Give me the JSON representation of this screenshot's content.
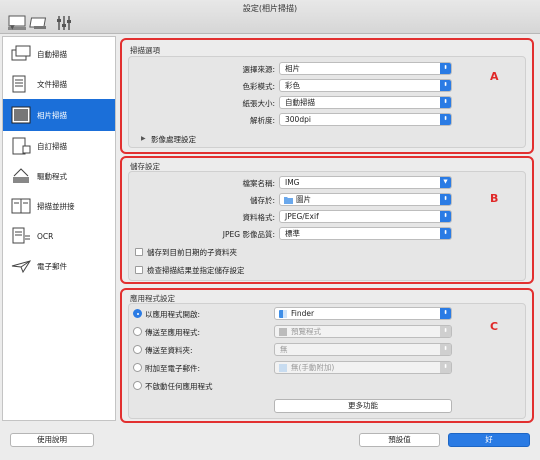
{
  "window": {
    "title": "設定(相片掃描)"
  },
  "sidebar": {
    "items": [
      {
        "label": "自動掃描",
        "icon": "auto-scan-icon"
      },
      {
        "label": "文件掃描",
        "icon": "document-scan-icon"
      },
      {
        "label": "相片掃描",
        "icon": "photo-scan-icon"
      },
      {
        "label": "自訂掃描",
        "icon": "custom-scan-icon"
      },
      {
        "label": "驅動程式",
        "icon": "driver-icon"
      },
      {
        "label": "掃描並拼接",
        "icon": "scan-stitch-icon"
      },
      {
        "label": "OCR",
        "icon": "ocr-icon"
      },
      {
        "label": "電子郵件",
        "icon": "email-icon"
      }
    ],
    "active_index": 2
  },
  "scan_options": {
    "title": "掃描選項",
    "letter": "A",
    "rows": [
      {
        "label": "選擇來源:",
        "value": "相片"
      },
      {
        "label": "色彩模式:",
        "value": "彩色"
      },
      {
        "label": "紙張大小:",
        "value": "自動掃描"
      },
      {
        "label": "解析度:",
        "value": "300dpi"
      }
    ],
    "image_processing": "影像處理設定"
  },
  "save_settings": {
    "title": "儲存設定",
    "letter": "B",
    "rows": [
      {
        "label": "檔案名稱:",
        "value": "IMG"
      },
      {
        "label": "儲存於:",
        "value": "圖片"
      },
      {
        "label": "資料格式:",
        "value": "JPEG/Exif"
      },
      {
        "label": "JPEG 影像品質:",
        "value": "標準"
      }
    ],
    "checkboxes": [
      "儲存到目前日期的子資料夾",
      "檢查掃描結果並指定儲存設定"
    ]
  },
  "app_settings": {
    "title": "應用程式設定",
    "letter": "C",
    "rows": [
      {
        "label": "以應用程式開啟:",
        "value": "Finder",
        "selected": true,
        "enabled": true
      },
      {
        "label": "傳送至應用程式:",
        "value": "預覽程式",
        "selected": false,
        "enabled": false
      },
      {
        "label": "傳送至資料夾:",
        "value": "無",
        "selected": false,
        "enabled": false
      },
      {
        "label": "附加至電子郵件:",
        "value": "無(手動附加)",
        "selected": false,
        "enabled": false
      }
    ],
    "no_app": "不啟動任何應用程式",
    "more_functions": "更多功能"
  },
  "footer": {
    "help": "使用說明",
    "defaults": "預設值",
    "ok": "好"
  },
  "colors": {
    "accent": "#2a7be4",
    "highlight": "#e23030"
  }
}
